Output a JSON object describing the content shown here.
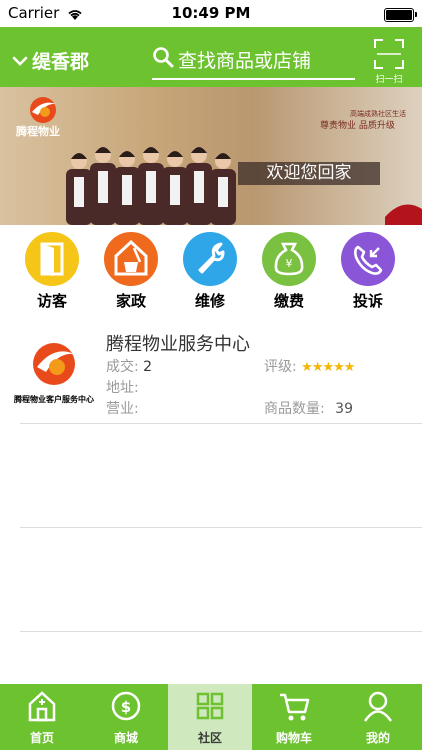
{
  "status_bar": {
    "carrier": "Carrier",
    "time": "10:49 PM"
  },
  "header": {
    "location": "缇香郡",
    "search_placeholder": "查找商品或店铺",
    "scan_label": "扫一扫",
    "accent_color": "#6dc22f"
  },
  "banner": {
    "brand": "腾程物业",
    "tagline_top": "高端成熟社区生活",
    "tagline_main": "尊贵物业 品质升级",
    "welcome": "欢迎您回家"
  },
  "services": [
    {
      "label": "访客",
      "icon": "door-icon",
      "color": "#f5c518"
    },
    {
      "label": "家政",
      "icon": "cleaning-icon",
      "color": "#f06a1e"
    },
    {
      "label": "维修",
      "icon": "wrench-icon",
      "color": "#2fa6e8"
    },
    {
      "label": "缴费",
      "icon": "money-bag-icon",
      "color": "#7ac142"
    },
    {
      "label": "投诉",
      "icon": "phone-incoming-icon",
      "color": "#8b55d8"
    }
  ],
  "shop": {
    "name": "腾程物业服务中心",
    "logo_caption": "腾程物业客户服务中心",
    "deals_label": "成交:",
    "deals_value": "2",
    "rating_label": "评级:",
    "rating_stars": 5,
    "address_label": "地址:",
    "hours_label": "营业:",
    "products_label": "商品数量:",
    "products_value": "39"
  },
  "tabbar": {
    "items": [
      {
        "label": "首页",
        "icon": "home-icon"
      },
      {
        "label": "商城",
        "icon": "coin-icon"
      },
      {
        "label": "社区",
        "icon": "grid-icon",
        "active": true
      },
      {
        "label": "购物车",
        "icon": "cart-icon"
      },
      {
        "label": "我的",
        "icon": "user-icon"
      }
    ]
  }
}
